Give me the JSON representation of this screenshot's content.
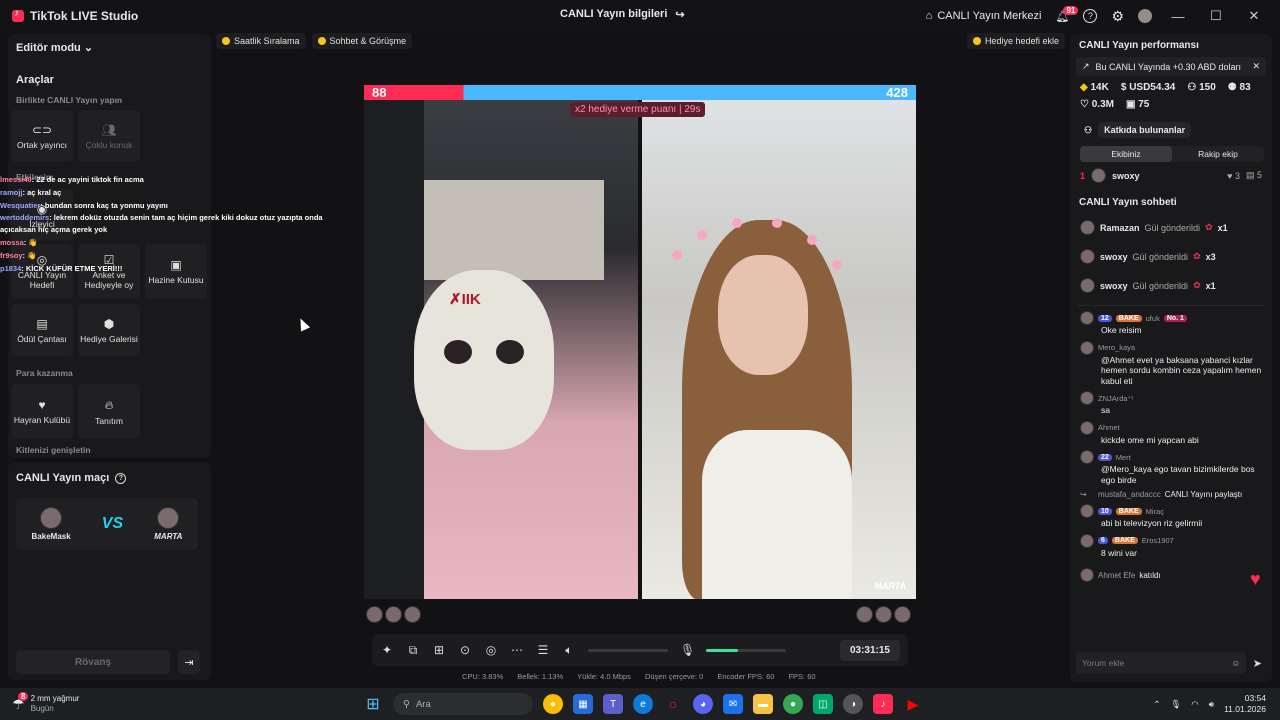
{
  "titlebar": {
    "app_name": "TikTok LIVE Studio",
    "center_title": "CANLI Yayın bilgileri",
    "live_center": "CANLI Yayın Merkezi",
    "notif_count": "91"
  },
  "left": {
    "editor_mode": "Editör modu",
    "tools_title": "Araçlar",
    "sections": {
      "together": "Birlikte CANLI Yayın yapın",
      "engagement": "Etkileşim",
      "monetize": "Para kazanma",
      "expand": "Kitlenizi genişletin"
    },
    "tiles": {
      "cohost": "Ortak yayıncı",
      "multi_guest": "Çoklu konuk",
      "live_goal": "CANLI Yayın Hedefi",
      "poll": "Anket ve Hediyeyle oy",
      "treasure": "Hazine Kutusu",
      "reward_bag": "Ödül Çantası",
      "gift_gallery": "Hediye Galerisi",
      "fan_club": "Hayran Kulübü",
      "promote": "Tanıtım",
      "viewers": "İzleyici"
    },
    "match_title": "CANLI Yayın maçı",
    "match_left": "BakeMask",
    "match_right": "MARTA",
    "vs": "VS",
    "rematch": "Rövanş"
  },
  "overlay_chat": [
    {
      "name": "lmessi40",
      "text": ": 22 de ac yayini tiktok fin acma"
    },
    {
      "name": "ramojj",
      "text": ": aç kral aç"
    },
    {
      "name": "Wesquatier",
      "text": ": bundan sonra kaç ta yonmu yayını"
    },
    {
      "name": "wertoddemirs",
      "text": ": lekrem doküz otuzda senin tam aç hiçim gerek kiki dokuz otuz yazıpta onda açıcaksan hiç açma gerek yok"
    },
    {
      "name": "mossa",
      "text": ": 👋"
    },
    {
      "name": "fr9soy",
      "text": ": 👋"
    },
    {
      "name": "p1834",
      "text": ": KİCK KÜFÜR ETME YERİ!!!"
    }
  ],
  "top_pills": {
    "hourly": "Saatlik Sıralama",
    "chat_meet": "Sohbet & Görüşme",
    "gift_goal": "Hediye hedefi ekle"
  },
  "battle": {
    "score_left": "88",
    "score_right": "428",
    "multiplier": "x2 hediye verme puanı",
    "countdown": "29s",
    "right_name": "MARTA"
  },
  "controls": {
    "timer": "03:31:15",
    "mic_level": 0.4
  },
  "stats": {
    "cpu": "CPU: 3.83%",
    "memory": "Bellek: 1.13%",
    "upload": "Yükle: 4.0 Mbps",
    "dropped": "Düşen çerçeve: 0",
    "encoder_fps": "Encoder FPS: 60",
    "fps": "FPS: 60"
  },
  "right": {
    "perf_title": "CANLI Yayın performansı",
    "earnings": "Bu CANLI Yayında +0.30 ABD doları",
    "metrics": {
      "diamonds": "14K",
      "usd": "USD54.34",
      "viewers": "150",
      "shares": "83",
      "likes": "0.3M",
      "gifters": "75"
    },
    "contributors": "Katkıda bulunanlar",
    "seg_ours": "Ekibiniz",
    "seg_rival": "Rakip ekip",
    "rank": {
      "pos": "1",
      "name": "swoxy",
      "hearts": "3",
      "gifts": "5"
    },
    "chat_title": "CANLI Yayın sohbeti",
    "gifts": [
      {
        "name": "Ramazan",
        "action": "Gül gönderildi",
        "count": "x1"
      },
      {
        "name": "swoxy",
        "action": "Gül gönderildi",
        "count": "x3"
      },
      {
        "name": "swoxy",
        "action": "Gül gönderildi",
        "count": "x1"
      }
    ],
    "comments": [
      {
        "lvl": "12",
        "bake": "BAKE",
        "user": "ufuk",
        "extra": "No. 1",
        "text": "Oke reisim"
      },
      {
        "lvl": "",
        "bake": "",
        "user": "Mero_kaya",
        "extra": "",
        "text": "@Ahmet evet ya baksana yabanci kızlar hemen sordu kombin ceza yapalım hemen kabul eti"
      },
      {
        "lvl": "",
        "bake": "",
        "user": "ZNJArda⁺ᵗ",
        "extra": "",
        "text": "sa"
      },
      {
        "lvl": "",
        "bake": "",
        "user": "Ahmet",
        "extra": "",
        "text": "kickde ome mi yapcan abi"
      },
      {
        "lvl": "22",
        "bake": "",
        "user": "Mert",
        "extra": "",
        "text": "@Mero_kaya ego tavan bizimkilerde bos ego birde"
      }
    ],
    "share": {
      "user": "mustafa_andaccc",
      "text": "CANLI Yayını paylaştı"
    },
    "comments2": [
      {
        "lvl": "10",
        "bake": "BAKE",
        "user": "Miraç",
        "text": "abi bi televizyon riz gelirmii"
      },
      {
        "lvl": "6",
        "bake": "BAKE",
        "user": "Eros1907",
        "text": "8 wini var"
      }
    ],
    "joined": {
      "user": "Ahmet Efe",
      "text": "katıldı"
    },
    "input_placeholder": "Yorum ekle"
  },
  "taskbar": {
    "weather": "2 mm yağmur",
    "weather_sub": "Bugün",
    "search": "Ara",
    "time": "03:54",
    "date": "11.01.2026",
    "weather_badge": "8"
  }
}
